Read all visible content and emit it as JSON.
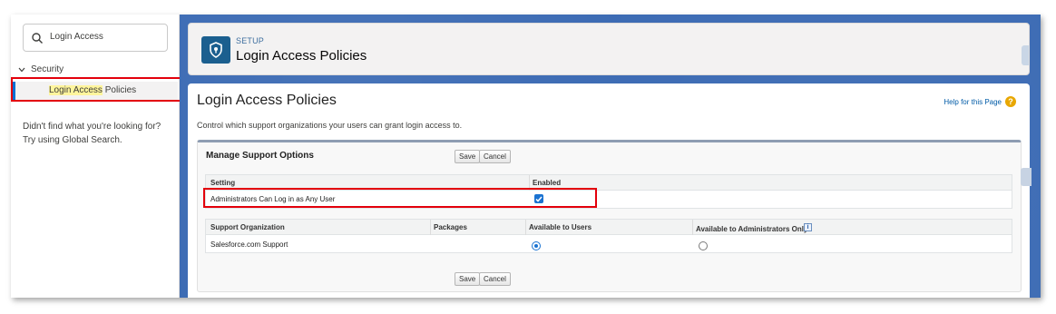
{
  "sidebar": {
    "search_value": "Login Access",
    "tree_section": "Security",
    "tree_item": {
      "highlight": "Login Access",
      "rest": " Policies"
    },
    "not_found": "Didn't find what you're looking for? Try using Global Search."
  },
  "header": {
    "setup_label": "SETUP",
    "title": "Login Access Policies"
  },
  "content": {
    "title": "Login Access Policies",
    "help_link": "Help for this Page",
    "description": "Control which support organizations your users can grant login access to.",
    "panel": {
      "title": "Manage Support Options",
      "save_label": "Save",
      "cancel_label": "Cancel",
      "settings_table": {
        "headers": [
          "Setting",
          "Enabled"
        ],
        "row": {
          "setting": "Administrators Can Log in as Any User",
          "enabled": true
        }
      },
      "org_table": {
        "headers": [
          "Support Organization",
          "Packages",
          "Available to Users",
          "Available to Administrators Only"
        ],
        "row": {
          "org": "Salesforce.com Support",
          "packages": "",
          "available_to_users": true,
          "available_to_admins_only": false
        }
      }
    }
  },
  "colors": {
    "highlight_box": "#e3000b",
    "accent": "#1a73d1",
    "background": "#3c6bb4"
  }
}
